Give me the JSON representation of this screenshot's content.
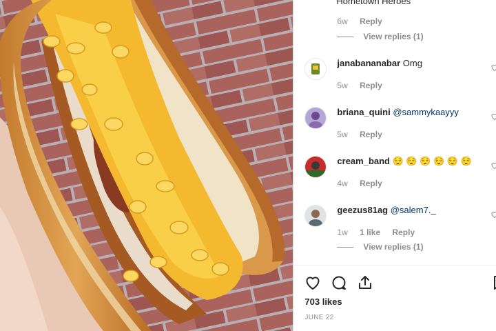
{
  "post": {
    "image": "mac-and-cheese-chicken-cutlet-hoagie-photo",
    "truncated_text": "Hometown Heroes"
  },
  "comments": [
    {
      "time": "6w",
      "reply_label": "Reply",
      "view_replies": "View replies (1)"
    },
    {
      "username": "janabananabar",
      "text": "Omg",
      "time": "5w",
      "reply_label": "Reply"
    },
    {
      "username": "briana_quini",
      "mention": "@sammykaayyy",
      "time": "5w",
      "reply_label": "Reply"
    },
    {
      "username": "cream_band",
      "emoji": "😌 😌 😌 😌 😌 😌",
      "time": "4w",
      "reply_label": "Reply"
    },
    {
      "username": "geezus81ag",
      "mention": "@salem7._",
      "time": "1w",
      "likes": "1 like",
      "reply_label": "Reply",
      "view_replies": "View replies (1)"
    }
  ],
  "actions": {
    "icons": [
      "heart-icon",
      "comment-icon",
      "share-icon",
      "bookmark-icon"
    ]
  },
  "likes_text": "703 likes",
  "date_text": "JUNE 22",
  "colors": {
    "text": "#262626",
    "muted": "#8e8e8e",
    "mention": "#00376b",
    "divider": "#efefef"
  }
}
